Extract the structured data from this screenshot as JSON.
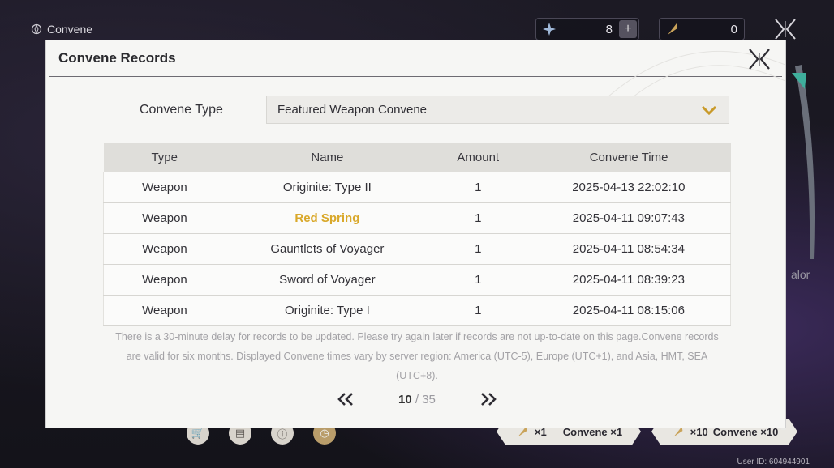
{
  "topbar": {
    "title": "Convene"
  },
  "currencies": [
    {
      "icon": "star-crystal-icon",
      "value": "8"
    },
    {
      "icon": "feather-token-icon",
      "value": "0"
    }
  ],
  "side_text": "alor",
  "modal": {
    "title": "Convene Records",
    "type_label": "Convene Type",
    "selected_type": "Featured Weapon Convene",
    "columns": [
      "Type",
      "Name",
      "Amount",
      "Convene Time"
    ],
    "rows": [
      {
        "type": "Weapon",
        "name": "Originite: Type II",
        "amount": "1",
        "time": "2025-04-13 22:02:10",
        "highlight": false
      },
      {
        "type": "Weapon",
        "name": "Red Spring",
        "amount": "1",
        "time": "2025-04-11 09:07:43",
        "highlight": true
      },
      {
        "type": "Weapon",
        "name": "Gauntlets of Voyager",
        "amount": "1",
        "time": "2025-04-11 08:54:34",
        "highlight": false
      },
      {
        "type": "Weapon",
        "name": "Sword of Voyager",
        "amount": "1",
        "time": "2025-04-11 08:39:23",
        "highlight": false
      },
      {
        "type": "Weapon",
        "name": "Originite: Type I",
        "amount": "1",
        "time": "2025-04-11 08:15:06",
        "highlight": false
      }
    ],
    "notice": "There is a 30-minute delay for records to be updated. Please try again later if records are not up-to-date on this page.Convene records are valid for six months. Displayed Convene times vary by server region: America (UTC-5), Europe (UTC+1), and Asia, HMT, SEA (UTC+8).",
    "pager": {
      "current": "10",
      "total": "35",
      "separator": " / "
    }
  },
  "bottom": {
    "buttons": [
      {
        "count": "×1",
        "label": "Convene ×1"
      },
      {
        "count": "×10",
        "label": "Convene ×10"
      }
    ],
    "user_id": "User ID: 604944901"
  },
  "colors": {
    "highlight": "#d9a82a",
    "modal_bg": "#f6f6f4",
    "header_row": "#dfdeda"
  }
}
